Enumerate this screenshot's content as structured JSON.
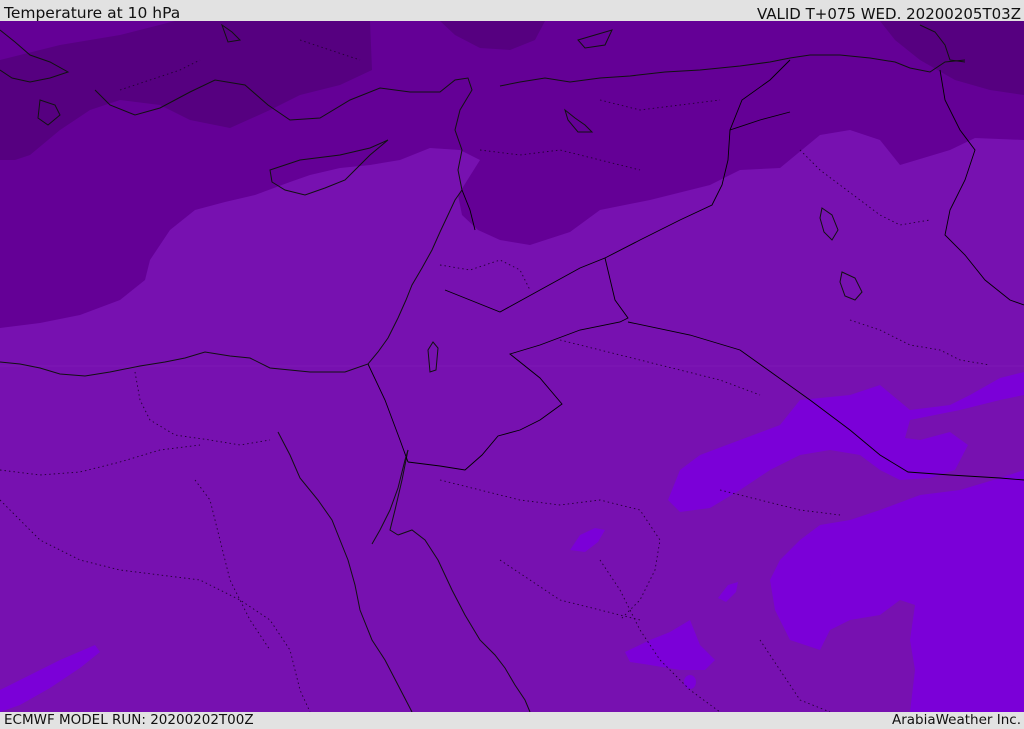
{
  "header": {
    "title": "Temperature at 10 hPa",
    "valid": "VALID T+075 WED. 20200205T03Z"
  },
  "footer": {
    "model_run": "ECMWF MODEL RUN: 20200202T00Z",
    "credit": "ArabiaWeather Inc."
  },
  "colors": {
    "band_darkest": "#560080",
    "band_dark": "#640096",
    "band_mid": "#7711b0",
    "band_light": "#7b00d8",
    "coastline": "#111111",
    "border": "#000000"
  }
}
